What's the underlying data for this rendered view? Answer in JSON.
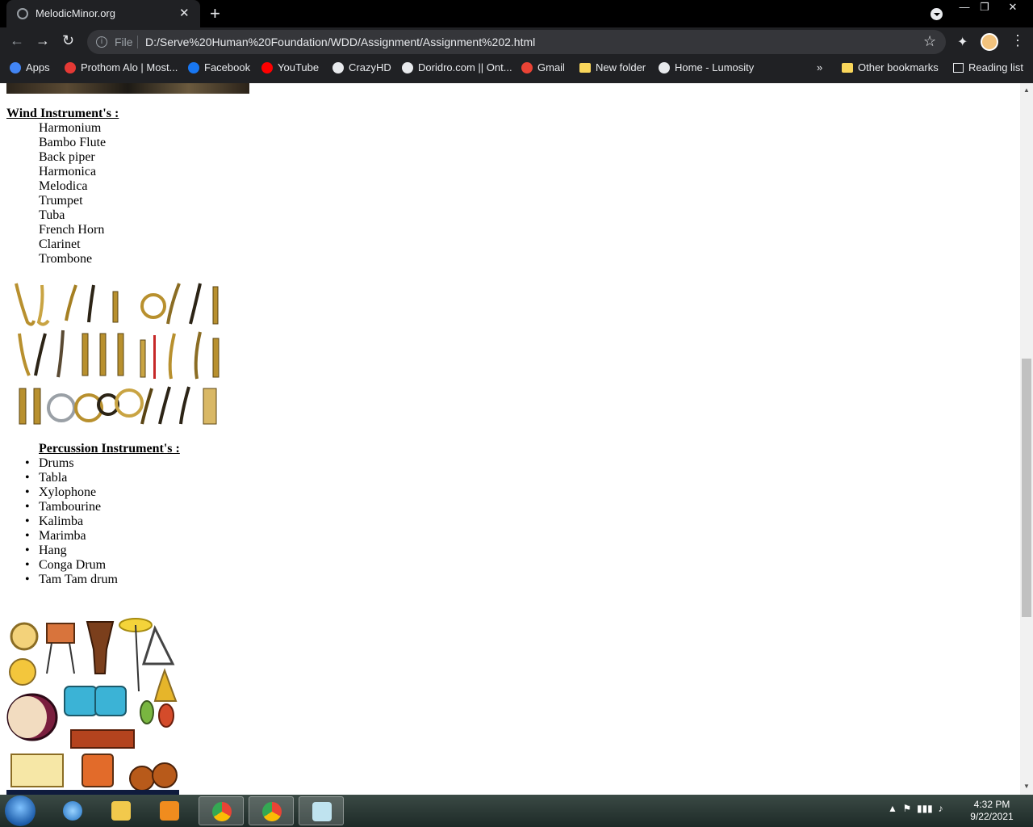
{
  "browser": {
    "tab_title": "MelodicMinor.org",
    "tab_close": "✕",
    "new_tab": "+",
    "url_scheme_label": "File",
    "url": "D:/Serve%20Human%20Foundation/WDD/Assignment/Assignment%202.html",
    "window_controls": {
      "minimize": "—",
      "restore": "❐",
      "close": "✕"
    },
    "bookmarks": [
      {
        "label": "Apps",
        "icon": "apps-grid-icon",
        "color": "#4285f4"
      },
      {
        "label": "Prothom Alo | Most...",
        "icon": "prothom-alo-icon",
        "color": "#e53935"
      },
      {
        "label": "Facebook",
        "icon": "facebook-icon",
        "color": "#1877f2"
      },
      {
        "label": "YouTube",
        "icon": "youtube-icon",
        "color": "#ff0000"
      },
      {
        "label": "CrazyHD",
        "icon": "globe-icon",
        "color": "#e8eaed"
      },
      {
        "label": "Doridro.com || Ont...",
        "icon": "globe-icon",
        "color": "#e8eaed"
      },
      {
        "label": "Gmail",
        "icon": "gmail-icon",
        "color": "#ea4335"
      },
      {
        "label": "New folder",
        "icon": "folder-icon",
        "color": "#f9d65b"
      },
      {
        "label": "Home - Lumosity",
        "icon": "globe-icon",
        "color": "#e8eaed"
      }
    ],
    "bookmarks_overflow": "»",
    "other_bookmarks": "Other bookmarks",
    "reading_list": "Reading list"
  },
  "page": {
    "wind_heading": "Wind Instrument's :",
    "wind_items": [
      "Harmonium",
      "Bambo Flute",
      "Back piper",
      "Harmonica",
      "Melodica",
      "Trumpet",
      "Tuba",
      "French Horn",
      "Clarinet",
      "Trombone"
    ],
    "percussion_heading": "Percussion Instrument's :",
    "percussion_items": [
      "Drums",
      "Tabla",
      "Xylophone",
      "Tambourine",
      "Kalimba",
      "Marimba",
      "Hang",
      "Conga Drum",
      "Tam Tam drum"
    ]
  },
  "taskbar": {
    "time": "4:32 PM",
    "date": "9/22/2021"
  }
}
